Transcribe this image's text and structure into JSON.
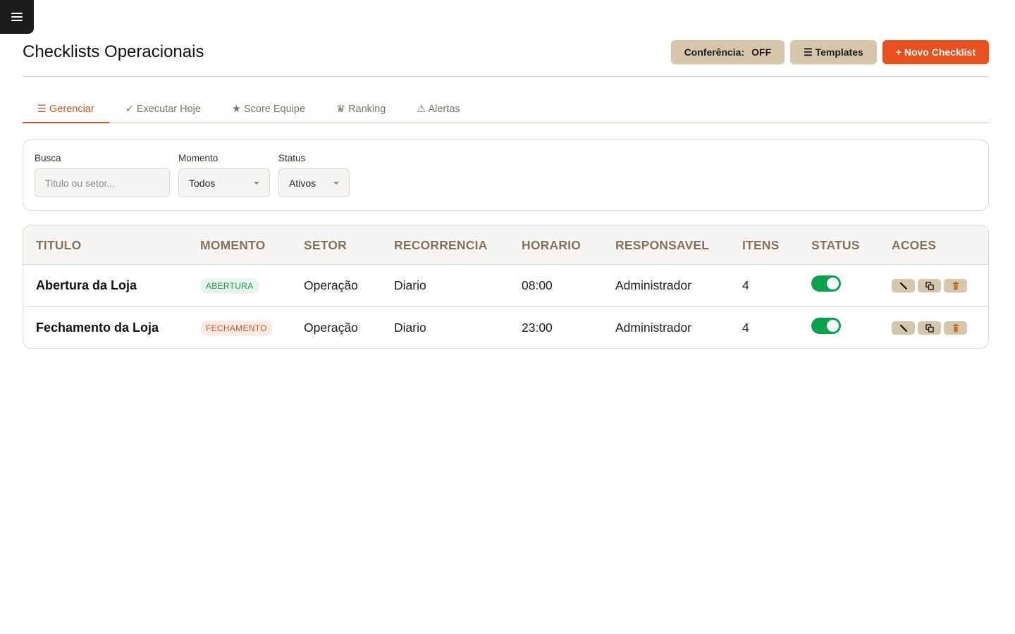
{
  "header": {
    "title": "Checklists Operacionais",
    "conferencia_label": "Conferência:",
    "conferencia_value": "OFF",
    "templates_label": "☰ Templates",
    "novo_label": "+ Novo Checklist"
  },
  "tabs": [
    {
      "label": "☰ Gerenciar",
      "active": true
    },
    {
      "label": "✓ Executar Hoje",
      "active": false
    },
    {
      "label": "★ Score Equipe",
      "active": false
    },
    {
      "label": "♛ Ranking",
      "active": false
    },
    {
      "label": "⚠ Alertas",
      "active": false
    }
  ],
  "filters": {
    "busca_label": "Busca",
    "busca_placeholder": "Titulo ou setor...",
    "momento_label": "Momento",
    "momento_value": "Todos",
    "status_label": "Status",
    "status_value": "Ativos"
  },
  "table": {
    "columns": [
      "TITULO",
      "MOMENTO",
      "SETOR",
      "RECORRENCIA",
      "HORARIO",
      "RESPONSAVEL",
      "ITENS",
      "STATUS",
      "ACOES"
    ],
    "rows": [
      {
        "titulo": "Abertura da Loja",
        "momento": "ABERTURA",
        "setor": "Operação",
        "recorrencia": "Diario",
        "horario": "08:00",
        "responsavel": "Administrador",
        "itens": "4",
        "active": true
      },
      {
        "titulo": "Fechamento da Loja",
        "momento": "FECHAMENTO",
        "setor": "Operação",
        "recorrencia": "Diario",
        "horario": "23:00",
        "responsavel": "Administrador",
        "itens": "4",
        "active": true
      }
    ]
  },
  "icons": {
    "menu": "hamburger-icon",
    "edit": "pencil-icon",
    "duplicate": "copy-icon",
    "delete": "trash-icon"
  },
  "colors": {
    "primary": "#e8501e",
    "tan": "#d6c7aa",
    "toggle_on": "#0aa24a",
    "header_text": "#86725c"
  }
}
